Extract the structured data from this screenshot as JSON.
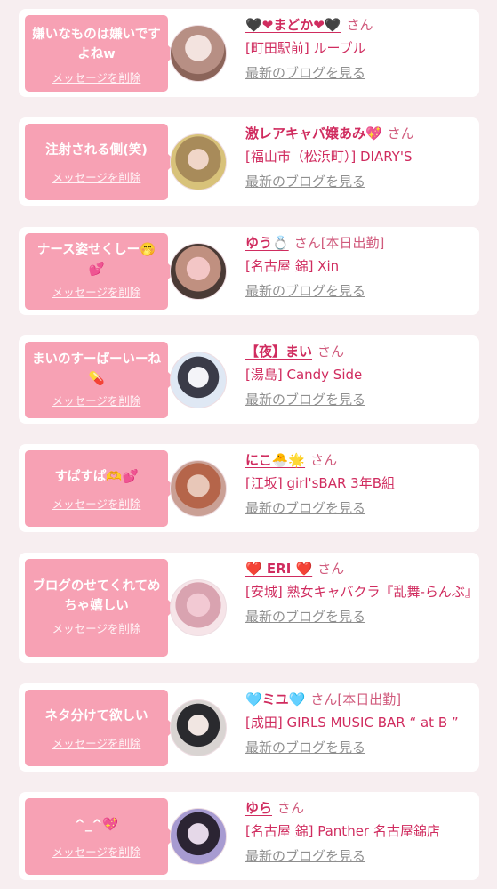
{
  "cards": [
    {
      "message": "嫌いなものは嫌いですよねw",
      "delete_label": "メッセージを削除",
      "name": "🖤❤まどか❤🖤",
      "san": "さん",
      "status": "",
      "shop": "[町田駅前] ルーブル",
      "blog_link": "最新のブログを見る",
      "avatar_colors": [
        "#e9d3d0",
        "#b78f84",
        "#8b6459"
      ]
    },
    {
      "message": "注射される側(笑)",
      "delete_label": "メッセージを削除",
      "name": "激レアキャバ嬢あみ💖",
      "san": "さん",
      "status": "",
      "shop": "[福山市（松浜町）] DIARY'S",
      "blog_link": "最新のブログを見る",
      "avatar_colors": [
        "#d8c27a",
        "#a88b5a",
        "#5b4630"
      ]
    },
    {
      "message": "ナース姿せくしー🤭💕",
      "delete_label": "メッセージを削除",
      "name": "ゆう💍",
      "san": "さん",
      "status": "[本日出勤]",
      "shop": "[名古屋 錦] Xin",
      "blog_link": "最新のブログを見る",
      "avatar_colors": [
        "#4a3a35",
        "#c09080",
        "#f3c6c6"
      ]
    },
    {
      "message": "まいのすーぱーいーね💊",
      "delete_label": "メッセージを削除",
      "name": "【夜】まい",
      "san": "さん",
      "status": "",
      "shop": "[湯島] Candy Side",
      "blog_link": "最新のブログを見る",
      "avatar_colors": [
        "#dfe8f4",
        "#3a3b48",
        "#f4f4f8"
      ]
    },
    {
      "message": "すぱすぱ🫶💕",
      "delete_label": "メッセージを削除",
      "name": "にこ🐣🌟",
      "san": "さん",
      "status": "",
      "shop": "[江坂] girl'sBAR 3年B組",
      "blog_link": "最新のブログを見る",
      "avatar_colors": [
        "#caa095",
        "#b5654a",
        "#e8c7b8"
      ]
    },
    {
      "message": "ブログのせてくれてめちゃ嬉しい",
      "delete_label": "メッセージを削除",
      "name": "❤️ ERI ❤️",
      "san": "さん",
      "status": "",
      "shop": "[安城] 熟女キャバクラ『乱舞-らんぶ』",
      "blog_link": "最新のブログを見る",
      "avatar_colors": [
        "#f2c9d3",
        "#d9a3b0",
        "#8a6a68"
      ]
    },
    {
      "message": "ネタ分けて欲しい",
      "delete_label": "メッセージを削除",
      "name": "🩵ミユ🩵",
      "san": "さん",
      "status": "[本日出勤]",
      "shop": "[成田] GIRLS MUSIC BAR “ at B ”",
      "blog_link": "最新のブログを見る",
      "avatar_colors": [
        "#d9d4d2",
        "#2a2a2e",
        "#b8b0ad"
      ]
    },
    {
      "message": "^_^💖",
      "delete_label": "メッセージを削除",
      "name": "ゆら",
      "san": "さん",
      "status": "",
      "shop": "[名古屋 錦] Panther 名古屋錦店",
      "blog_link": "最新のブログを見る",
      "avatar_colors": [
        "#a79bd1",
        "#2b2433",
        "#e5d8e8"
      ]
    }
  ]
}
